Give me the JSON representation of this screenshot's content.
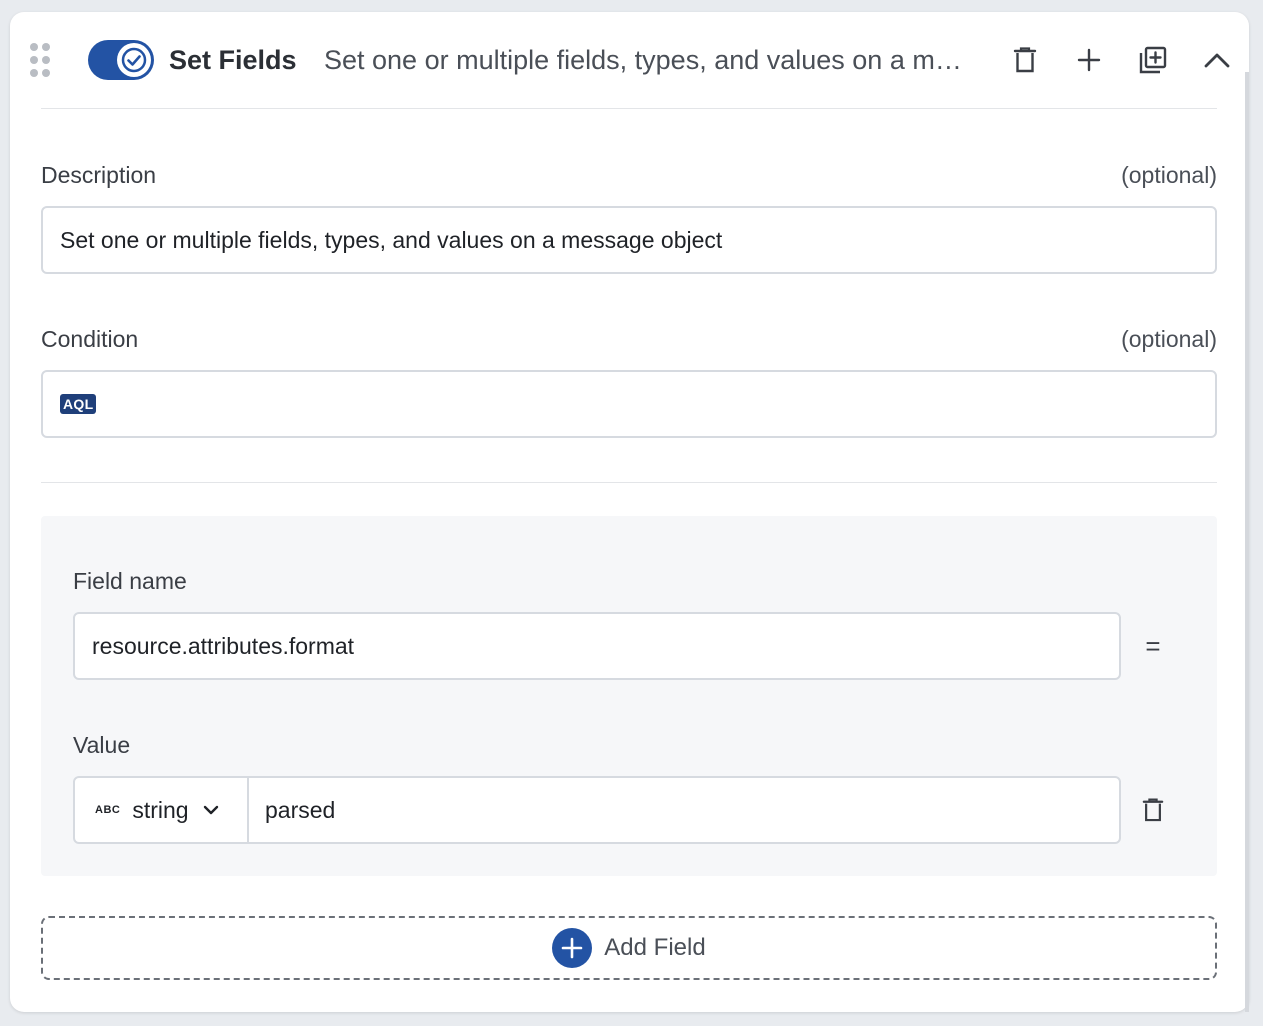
{
  "header": {
    "title": "Set Fields",
    "subtitle": "Set one or multiple fields, types, and values on a message object",
    "toggle_enabled": true,
    "icons": [
      "drag-handle-icon",
      "check-icon",
      "trash-icon",
      "plus-icon",
      "duplicate-icon",
      "chevron-up-icon"
    ]
  },
  "description": {
    "label": "Description",
    "optional": "(optional)",
    "value": "Set one or multiple fields, types, and values on a message object"
  },
  "condition": {
    "label": "Condition",
    "optional": "(optional)",
    "badge": "AQL",
    "value": ""
  },
  "field": {
    "name_label": "Field name",
    "name_value": "resource.attributes.format",
    "operator": "=",
    "value_label": "Value",
    "type_badge": "ABC",
    "type": "string",
    "value": "parsed"
  },
  "add_field": {
    "label": "Add Field"
  },
  "colors": {
    "accent": "#2353a4",
    "badge": "#1f3f7a",
    "border": "#d6dae0",
    "panel": "#f6f7f9"
  }
}
